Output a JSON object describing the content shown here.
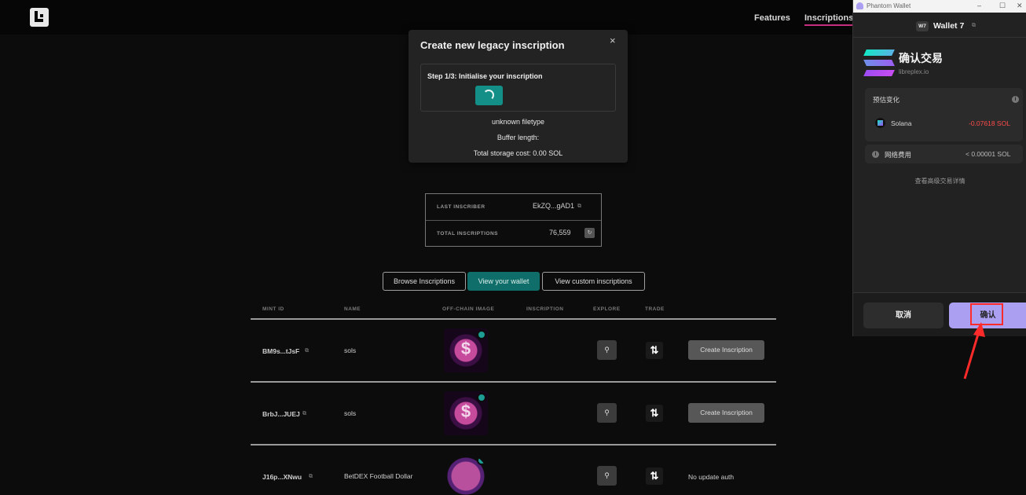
{
  "header": {
    "nav": [
      {
        "label": "Features"
      },
      {
        "label": "Inscriptions"
      }
    ]
  },
  "modal": {
    "title": "Create new legacy inscription",
    "close": "×",
    "step": "Step 1/3: Initialise your inscription",
    "filetype": "unknown filetype",
    "buffer": "Buffer length:",
    "storage": "Total storage cost: 0.00 SOL"
  },
  "stats": {
    "last_label": "LAST INSCRIBER",
    "last_value": "EkZQ...gAD1",
    "total_label": "TOTAL INSCRIPTIONS",
    "total_value": "76,559"
  },
  "filters": [
    {
      "label": "Browse Inscriptions"
    },
    {
      "label": "View your wallet"
    },
    {
      "label": "View custom inscriptions"
    }
  ],
  "table": {
    "headers": [
      "MINT ID",
      "NAME",
      "OFF-CHAIN IMAGE",
      "INSCRIPTION",
      "EXPLORE",
      "TRADE"
    ],
    "rows": [
      {
        "mint": "BM9s...tJsF",
        "name": "sols",
        "action": "Create Inscription"
      },
      {
        "mint": "BrbJ...JUEJ",
        "name": "sols",
        "action": "Create Inscription"
      },
      {
        "mint": "J16p...XNwu",
        "name": "BetDEX Football Dollar",
        "action": "No update auth"
      }
    ]
  },
  "phantom": {
    "window_title": "Phantom Wallet",
    "avatar": "W7",
    "wallet": "Wallet 7",
    "heading": "确认交易",
    "site": "libreplex.io",
    "est_label": "预估变化",
    "token": "Solana",
    "token_change": "-0.07618 SOL",
    "fee_label": "网络费用",
    "fee_value": "< 0.00001 SOL",
    "advanced": "查看高级交易详情",
    "cancel": "取消",
    "confirm": "确认"
  },
  "colors": {
    "accent_teal": "#138f87",
    "phantom_purple": "#ab9ff2",
    "negative_red": "#ff4b4b",
    "highlight_red": "#ff2a2a",
    "nav_underline": "#c32f7c"
  }
}
